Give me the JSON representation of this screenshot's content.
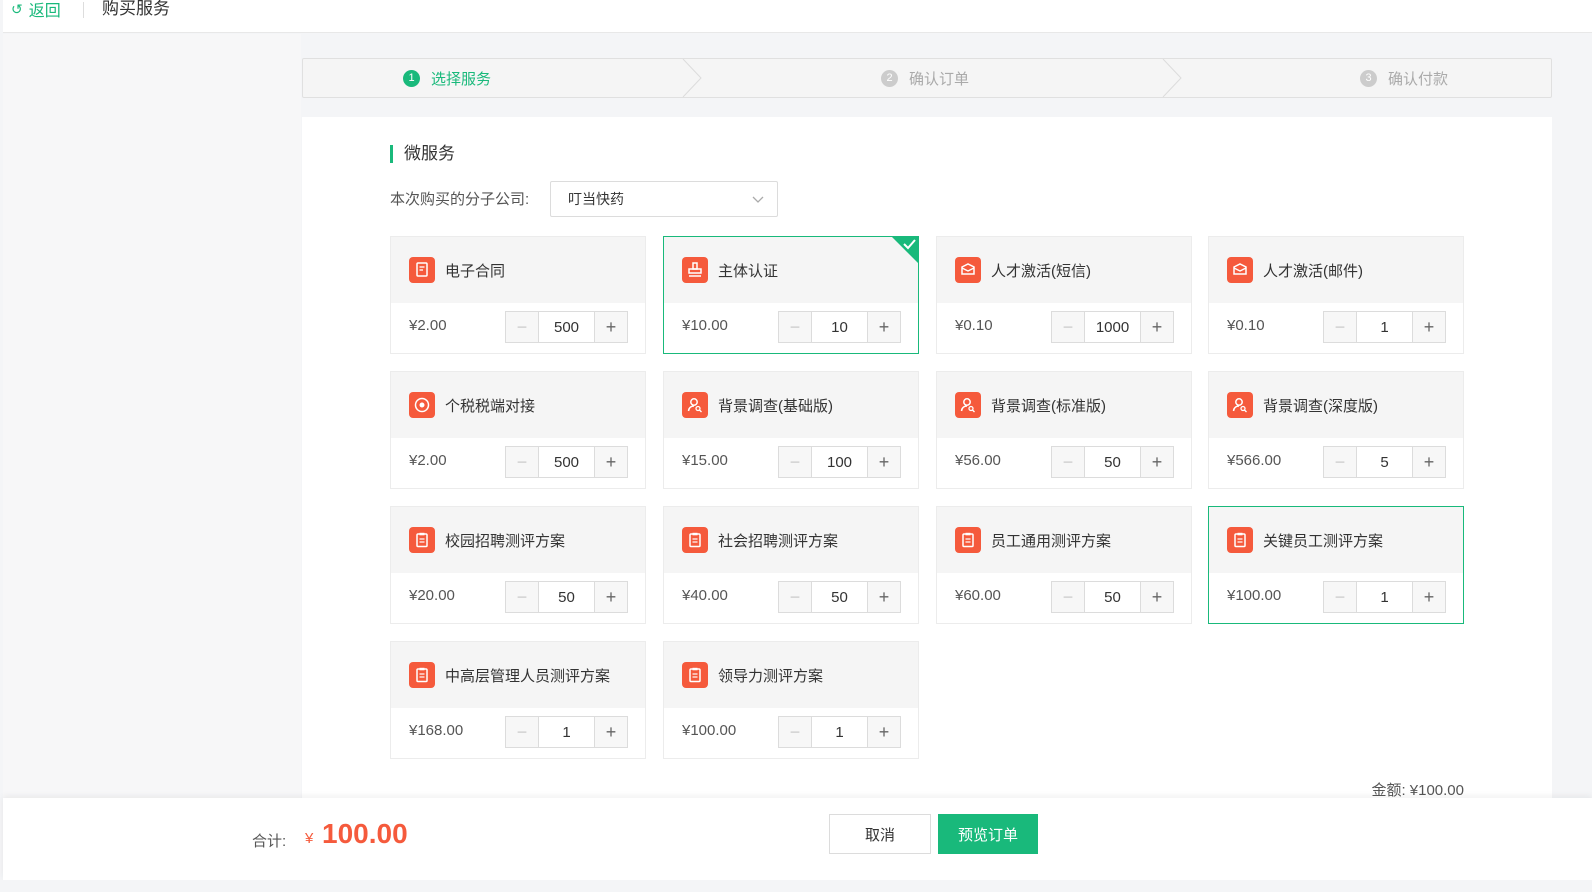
{
  "topbar": {
    "back_label": "返回",
    "title": "购买服务"
  },
  "steps": [
    {
      "num": "1",
      "label": "选择服务",
      "active": true
    },
    {
      "num": "2",
      "label": "确认订单",
      "active": false
    },
    {
      "num": "3",
      "label": "确认付款",
      "active": false
    }
  ],
  "section": {
    "title": "微服务",
    "company_label": "本次购买的分子公司:",
    "company_value": "叮当快药"
  },
  "services": [
    {
      "name": "电子合同",
      "price": "¥2.00",
      "qty": "500",
      "icon": "contract-icon",
      "selected": false
    },
    {
      "name": "主体认证",
      "price": "¥10.00",
      "qty": "10",
      "icon": "stamp-icon",
      "selected": true
    },
    {
      "name": "人才激活(短信)",
      "price": "¥0.10",
      "qty": "1000",
      "icon": "activation-icon",
      "selected": false
    },
    {
      "name": "人才激活(邮件)",
      "price": "¥0.10",
      "qty": "1",
      "icon": "activation-icon",
      "selected": false
    },
    {
      "name": "个税税端对接",
      "price": "¥2.00",
      "qty": "500",
      "icon": "tax-icon",
      "selected": false
    },
    {
      "name": "背景调查(基础版)",
      "price": "¥15.00",
      "qty": "100",
      "icon": "person-search-icon",
      "selected": false
    },
    {
      "name": "背景调查(标准版)",
      "price": "¥56.00",
      "qty": "50",
      "icon": "person-search-icon",
      "selected": false
    },
    {
      "name": "背景调查(深度版)",
      "price": "¥566.00",
      "qty": "5",
      "icon": "person-search-icon",
      "selected": false
    },
    {
      "name": "校园招聘测评方案",
      "price": "¥20.00",
      "qty": "50",
      "icon": "clipboard-icon",
      "selected": false
    },
    {
      "name": "社会招聘测评方案",
      "price": "¥40.00",
      "qty": "50",
      "icon": "clipboard-icon",
      "selected": false
    },
    {
      "name": "员工通用测评方案",
      "price": "¥60.00",
      "qty": "50",
      "icon": "clipboard-icon",
      "selected": false
    },
    {
      "name": "关键员工测评方案",
      "price": "¥100.00",
      "qty": "1",
      "icon": "clipboard-icon",
      "selected": true
    },
    {
      "name": "中高层管理人员测评方案",
      "price": "¥168.00",
      "qty": "1",
      "icon": "clipboard-icon",
      "selected": false
    },
    {
      "name": "领导力测评方案",
      "price": "¥100.00",
      "qty": "1",
      "icon": "clipboard-icon",
      "selected": false
    }
  ],
  "amount_label": "金额: ¥100.00",
  "footer": {
    "total_label": "合计:",
    "total_currency": "¥",
    "total_value": "100.00",
    "cancel_label": "取消",
    "preview_label": "预览订单"
  },
  "colors": {
    "accent": "#19b97b",
    "icon_bg": "#f55a3c",
    "price_red": "#f55a3c"
  }
}
